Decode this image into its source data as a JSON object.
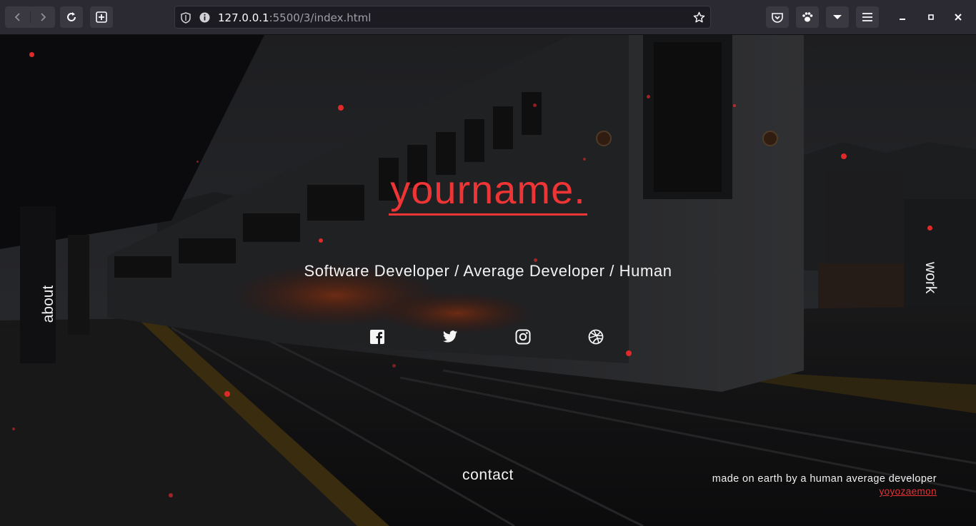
{
  "browser": {
    "url_host": "127.0.0.1",
    "url_path": ":5500/3/index.html"
  },
  "hero": {
    "name": "yourname.",
    "subtitle": "Software Developer / Average Developer / Human"
  },
  "social": [
    {
      "icon": "facebook-icon"
    },
    {
      "icon": "twitter-icon"
    },
    {
      "icon": "instagram-icon"
    },
    {
      "icon": "dribbble-icon"
    }
  ],
  "nav": {
    "about": "about",
    "work": "work",
    "contact": "contact"
  },
  "footer": {
    "credit": "made on earth by a human average developer",
    "author": "yoyozaemon"
  },
  "colors": {
    "accent": "#ee3434",
    "text": "#f3f3f3",
    "chrome": "#2b2a33"
  }
}
